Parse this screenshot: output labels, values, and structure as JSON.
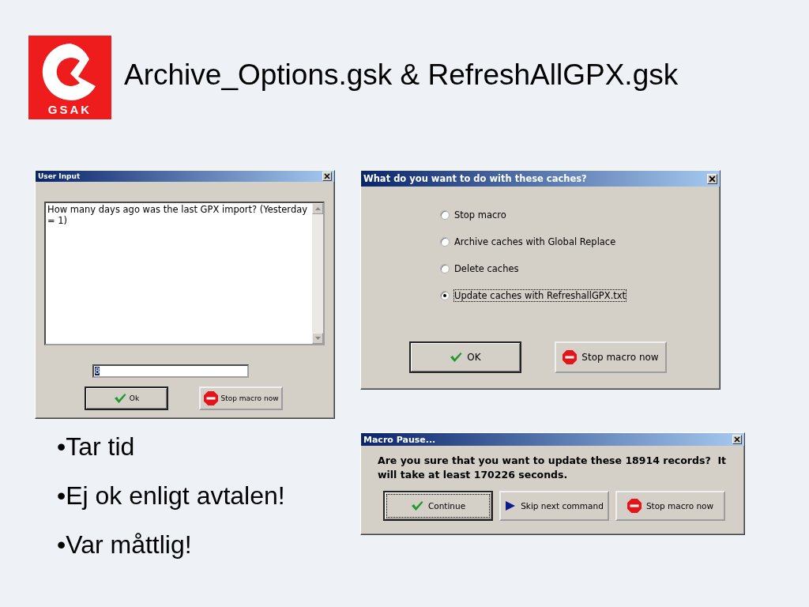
{
  "logo": {
    "text": "GSAK"
  },
  "title": "Archive_Options.gsk & RefreshAllGPX.gsk",
  "user_input_dialog": {
    "title": "User Input",
    "prompt": "How many days ago was the last GPX import? (Yesterday = 1)",
    "value": "8",
    "buttons": [
      {
        "label": "Ok",
        "kind": "check",
        "default": true
      },
      {
        "label": "Stop macro now",
        "kind": "stop",
        "default": false
      }
    ]
  },
  "choice_dialog": {
    "title": "What do you want to do with these caches?",
    "options": [
      {
        "label": "Stop macro",
        "selected": false
      },
      {
        "label": "Archive caches with Global Replace",
        "selected": false
      },
      {
        "label": "Delete caches",
        "selected": false
      },
      {
        "label": "Update caches with RefreshallGPX.txt",
        "selected": true
      }
    ],
    "buttons": [
      {
        "label": "OK",
        "kind": "check",
        "default": true
      },
      {
        "label": "Stop macro now",
        "kind": "stop",
        "default": false
      }
    ]
  },
  "bullets": [
    "•Tar tid",
    "•Ej ok enligt avtalen!",
    "•Var måttlig!"
  ],
  "pause_dialog": {
    "title": "Macro Pause...",
    "message": "Are you sure that you want to update these 18914 records?  It will take at least 170226 seconds.",
    "buttons": [
      {
        "label": "Continue",
        "kind": "check",
        "default": true
      },
      {
        "label": "Skip next command",
        "kind": "play",
        "default": false
      },
      {
        "label": "Stop macro now",
        "kind": "stop",
        "default": false
      }
    ]
  }
}
